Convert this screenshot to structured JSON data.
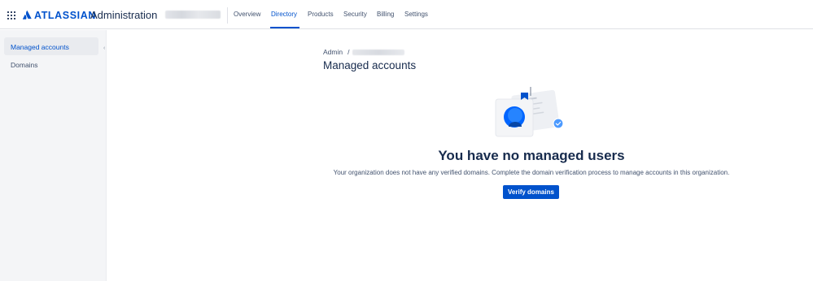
{
  "brand": {
    "logo_text": "ATLASSIAN",
    "product": "Administration",
    "accent": "#0052cc"
  },
  "nav": {
    "tabs": [
      {
        "label": "Overview"
      },
      {
        "label": "Directory",
        "active": true
      },
      {
        "label": "Products"
      },
      {
        "label": "Security"
      },
      {
        "label": "Billing"
      },
      {
        "label": "Settings"
      }
    ]
  },
  "sidebar": {
    "items": [
      {
        "label": "Managed accounts",
        "selected": true
      },
      {
        "label": "Domains"
      }
    ]
  },
  "breadcrumb": {
    "root": "Admin",
    "separator": "/"
  },
  "page": {
    "title": "Managed accounts"
  },
  "empty_state": {
    "heading": "You have no managed users",
    "description": "Your organization does not have any verified domains. Complete the domain verification process to manage accounts in this organization.",
    "button_label": "Verify domains"
  },
  "icons": {
    "app_switcher": "app-switcher-grid-icon",
    "logo": "atlassian-logo-icon",
    "collapse": "chevron-left-icon"
  }
}
